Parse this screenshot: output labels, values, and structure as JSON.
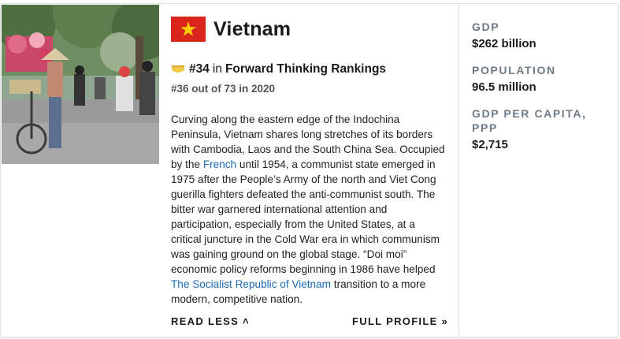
{
  "country": {
    "name": "Vietnam",
    "flag_colors": {
      "field": "#da251d",
      "star": "#ffcd00"
    }
  },
  "ranking": {
    "rank": "#34",
    "connector": "in",
    "name": "Forward Thinking Rankings",
    "previous": "#36 out of 73 in 2020",
    "medal_color": "#f2c84b"
  },
  "description": {
    "part1": "Curving along the eastern edge of the Indochina Peninsula, Vietnam shares long stretches of its borders with Cambodia, Laos and the South China Sea. Occupied by the ",
    "link1": "French",
    "part2": " until 1954, a communist state emerged in 1975 after the People’s Army of the north and Viet Cong guerilla fighters defeated the anti-communist south. The bitter war garnered international attention and participation, especially from the United States, at a critical juncture in the Cold War era in which communism was gaining ground on the global stage. “Doi moi” economic policy reforms beginning in 1986 have helped ",
    "link2": "The Socialist Republic of Vietnam",
    "part3": " transition to a more modern, competitive nation.",
    "link_color": "#1c6bb8"
  },
  "actions": {
    "read_less": "READ LESS ˄",
    "full_profile": "FULL PROFILE »"
  },
  "stats": [
    {
      "label": "GDP",
      "value": "$262 billion"
    },
    {
      "label": "POPULATION",
      "value": "96.5 million"
    },
    {
      "label": "GDP PER CAPITA, PPP",
      "value": "$2,715"
    }
  ]
}
